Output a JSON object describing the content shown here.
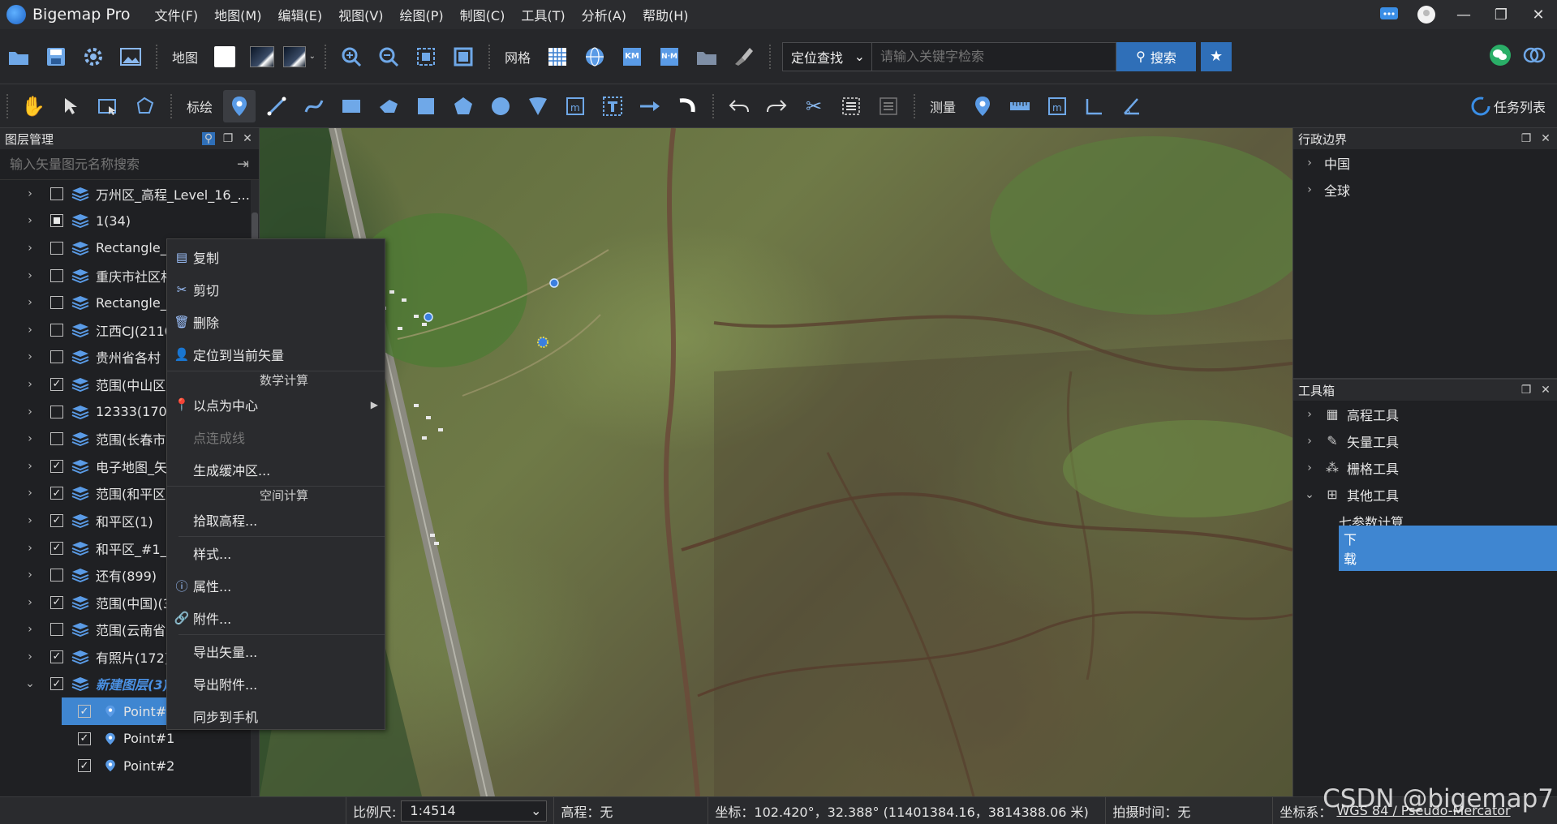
{
  "app": {
    "title": "Bigemap Pro",
    "menu": [
      "文件(F)",
      "地图(M)",
      "编辑(E)",
      "视图(V)",
      "绘图(P)",
      "制图(C)",
      "工具(T)",
      "分析(A)",
      "帮助(H)"
    ]
  },
  "toolbar1": {
    "map_label": "地图",
    "grid_label": "网格",
    "search_category": "定位查找",
    "search_placeholder": "请输入关键字检索",
    "search_button": "搜索",
    "km_label": "KM",
    "nm_label": "N·M"
  },
  "toolbar2": {
    "draw_label": "标绘",
    "measure_label": "测量",
    "task_list_label": "任务列表"
  },
  "layer_panel": {
    "title": "图层管理",
    "search_placeholder": "输入矢量图元名称搜索",
    "layers": [
      {
        "name": "万州区_高程_Level_16_...",
        "checked": "none"
      },
      {
        "name": "1(34)",
        "checked": "partial"
      },
      {
        "name": "Rectangle_",
        "checked": "none"
      },
      {
        "name": "重庆市社区村",
        "checked": "none"
      },
      {
        "name": "Rectangle_",
        "checked": "none"
      },
      {
        "name": "江西CJ(2110",
        "checked": "none"
      },
      {
        "name": "贵州省各村",
        "checked": "none"
      },
      {
        "name": "范围(中山区",
        "checked": "checked"
      },
      {
        "name": "12333(170)",
        "checked": "none"
      },
      {
        "name": "范围(长春市",
        "checked": "none"
      },
      {
        "name": "电子地图_矢",
        "checked": "checked"
      },
      {
        "name": "范围(和平区",
        "checked": "checked"
      },
      {
        "name": "和平区(1)",
        "checked": "checked"
      },
      {
        "name": "和平区_#1_",
        "checked": "checked"
      },
      {
        "name": "还有(899)",
        "checked": "none"
      },
      {
        "name": "范围(中国)(3",
        "checked": "checked"
      },
      {
        "name": "范围(云南省",
        "checked": "none"
      },
      {
        "name": "有照片(172)",
        "checked": "checked"
      },
      {
        "name": "新建图层(3)",
        "checked": "checked",
        "italic": true,
        "expanded": true
      }
    ],
    "points": [
      {
        "name": "Point#0",
        "selected": true
      },
      {
        "name": "Point#1"
      },
      {
        "name": "Point#2"
      }
    ]
  },
  "context_menu": {
    "copy": "复制",
    "cut": "剪切",
    "delete": "删除",
    "locate": "定位到当前矢量",
    "section_math": "数学计算",
    "center_point": "以点为中心",
    "connect_line": "点连成线",
    "buffer": "生成缓冲区...",
    "section_spatial": "空间计算",
    "pick_elevation": "拾取高程...",
    "style": "样式...",
    "properties": "属性...",
    "attachment": "附件...",
    "export_vector": "导出矢量...",
    "export_attachment": "导出附件...",
    "sync_phone": "同步到手机"
  },
  "admin_panel": {
    "title": "行政边界",
    "items": [
      "中国",
      "全球"
    ]
  },
  "toolbox_panel": {
    "title": "工具箱",
    "groups": [
      "高程工具",
      "矢量工具",
      "栅格工具",
      "其他工具"
    ],
    "children": [
      "七参数计算",
      "下载"
    ]
  },
  "statusbar": {
    "scale_label": "比例尺:",
    "scale_value": "1:4514",
    "elevation": "高程：无",
    "coords": "坐标：102.420°，32.388°  (11401384.16，3814388.06 米)",
    "capture_time": "拍摄时间：无",
    "crs_label": "坐标系：",
    "crs_value": "WGS 84 / Pseudo-Mercator",
    "watermark": "CSDN @bigemap7"
  },
  "colors": {
    "accent": "#2f6fb8",
    "highlight": "#3f86d1",
    "marker": "#3b7fe0"
  }
}
